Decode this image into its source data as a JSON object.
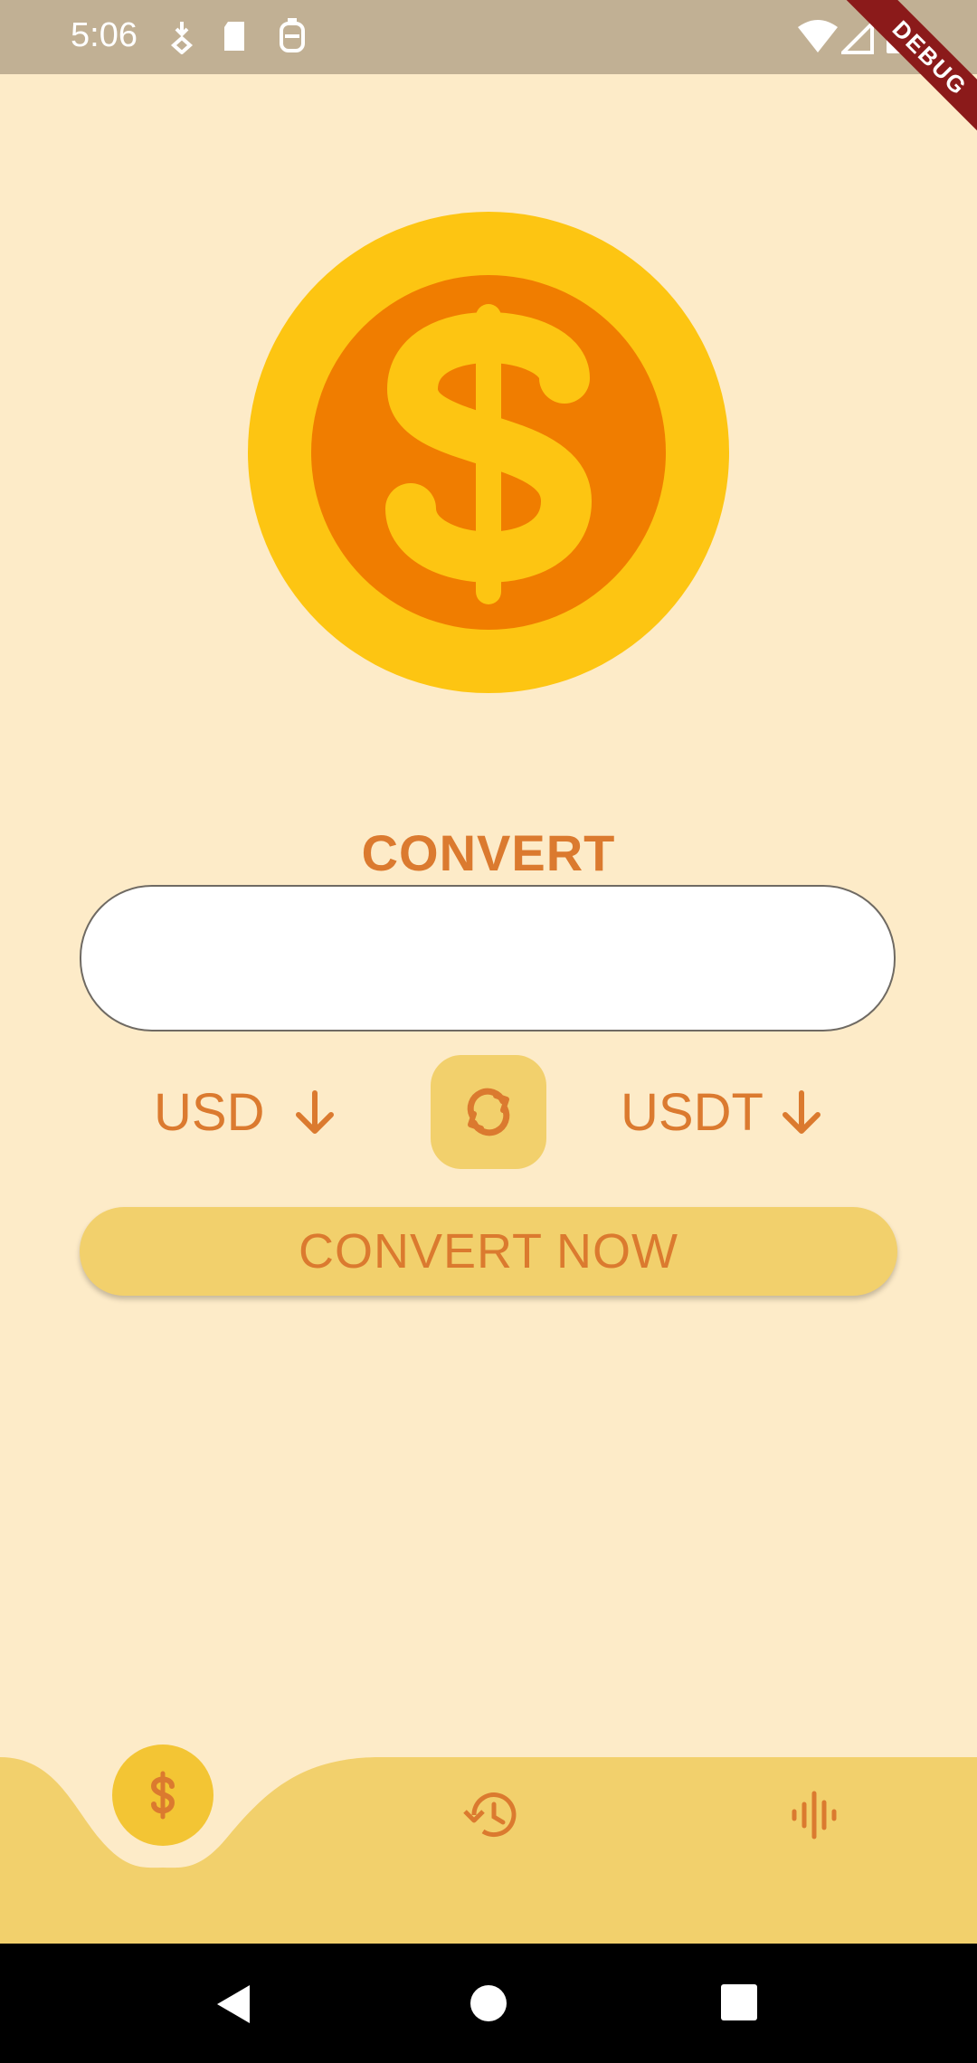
{
  "status_bar": {
    "time": "5:06",
    "left_icons": [
      "download-icon",
      "sd-card-icon",
      "vpn-icon"
    ],
    "right_icons": [
      "wifi-icon",
      "signal-icon",
      "battery-icon"
    ]
  },
  "debug_banner": {
    "label": "DEBUG"
  },
  "logo": {
    "icon": "dollar-coin-icon",
    "outer_color": "#FDC512",
    "inner_color": "#F07D00"
  },
  "converter": {
    "title": "CONVERT",
    "amount": {
      "value": "",
      "placeholder": ""
    },
    "from_currency": "USD",
    "to_currency": "USDT",
    "swap_icon": "swap-icon",
    "convert_button_label": "CONVERT NOW"
  },
  "bottom_nav": {
    "items": [
      {
        "icon": "dollar-icon",
        "active": true
      },
      {
        "icon": "history-icon",
        "active": false
      },
      {
        "icon": "chart-icon",
        "active": false
      }
    ]
  },
  "system_nav": {
    "icons": [
      "back-icon",
      "home-icon",
      "recents-icon"
    ]
  },
  "colors": {
    "background": "#FDEBC8",
    "accent": "#DB7A2F",
    "button": "#F2D06C",
    "status_bar": "#C1B094"
  }
}
